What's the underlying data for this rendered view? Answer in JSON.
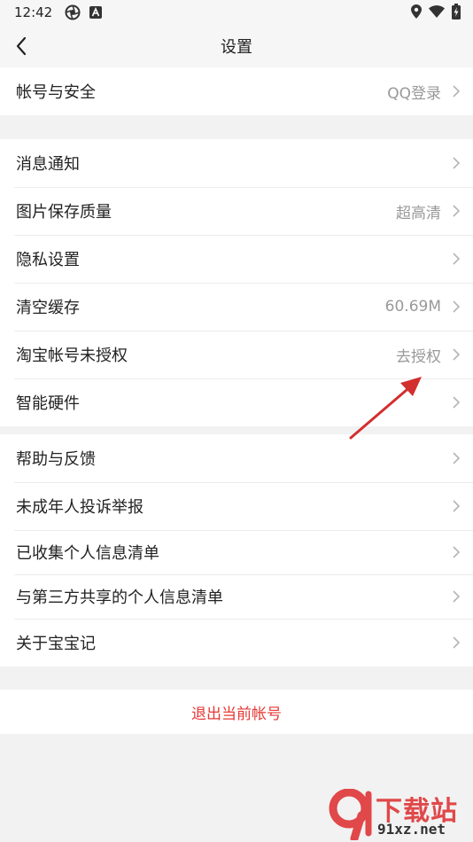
{
  "status_bar": {
    "time": "12:42",
    "icons_left": [
      "aperture-icon",
      "a-badge-icon"
    ],
    "icons_right": [
      "location-icon",
      "wifi-icon",
      "battery-charging-icon"
    ]
  },
  "header": {
    "title": "设置",
    "back_icon": "chevron-left-icon"
  },
  "groups": [
    {
      "items": [
        {
          "label": "帐号与安全",
          "value": "QQ登录"
        }
      ]
    },
    {
      "items": [
        {
          "label": "消息通知",
          "value": ""
        },
        {
          "label": "图片保存质量",
          "value": "超高清"
        },
        {
          "label": "隐私设置",
          "value": ""
        },
        {
          "label": "清空缓存",
          "value": "60.69M"
        },
        {
          "label": "淘宝帐号未授权",
          "value": "去授权"
        },
        {
          "label": "智能硬件",
          "value": ""
        }
      ]
    },
    {
      "items": [
        {
          "label": "帮助与反馈",
          "value": ""
        },
        {
          "label": "未成年人投诉举报",
          "value": ""
        },
        {
          "label": "已收集个人信息清单",
          "value": ""
        },
        {
          "label": "与第三方共享的个人信息清单",
          "value": ""
        },
        {
          "label": "关于宝宝记",
          "value": ""
        }
      ]
    }
  ],
  "logout": {
    "label": "退出当前帐号"
  },
  "watermark": {
    "top": "下载站",
    "bottom": "91xz.net"
  },
  "colors": {
    "accent_red": "#e53935",
    "annotation_arrow": "#d32f2f",
    "value_gray": "#999999"
  }
}
